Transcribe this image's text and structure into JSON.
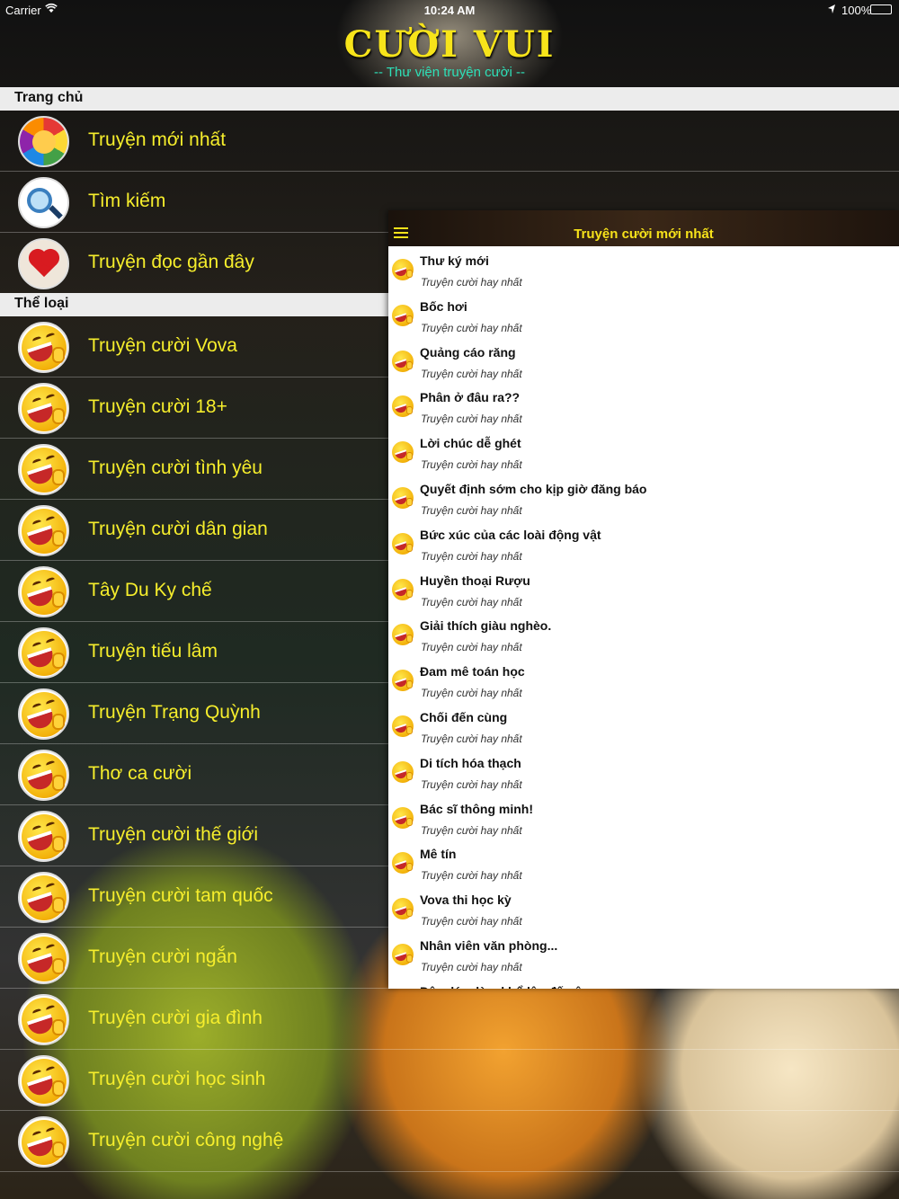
{
  "status_bar": {
    "carrier": "Carrier",
    "time": "10:24 AM",
    "battery": "100%"
  },
  "header": {
    "title": "CƯỜI VUI",
    "subtitle": "-- Thư viện truyện cười --"
  },
  "sections": {
    "home": "Trang chủ",
    "categories": "Thể loại"
  },
  "home_items": [
    {
      "label": "Truyện mới nhất",
      "icon": "clown-icon"
    },
    {
      "label": "Tìm kiếm",
      "icon": "search-icon"
    },
    {
      "label": "Truyện đọc gần đây",
      "icon": "heart-icon"
    }
  ],
  "category_items": [
    {
      "label": "Truyện cười Vova"
    },
    {
      "label": "Truyện cười 18+"
    },
    {
      "label": "Truyện cười tình yêu"
    },
    {
      "label": "Truyện cười dân gian"
    },
    {
      "label": "Tây Du Ky chế"
    },
    {
      "label": "Truyện tiếu lâm"
    },
    {
      "label": "Truyện Trạng Quỳnh"
    },
    {
      "label": "Thơ ca cười"
    },
    {
      "label": "Truyện cười thế giới"
    },
    {
      "label": "Truyện cười tam quốc"
    },
    {
      "label": "Truyện cười ngắn"
    },
    {
      "label": "Truyện cười gia đình"
    },
    {
      "label": "Truyện cười học sinh"
    },
    {
      "label": "Truyện cười công nghệ"
    }
  ],
  "panel": {
    "title": "Truyện cười mới nhất",
    "stories": [
      {
        "title": "Thư ký mới",
        "category": "Truyện cười hay nhất"
      },
      {
        "title": "Bốc hơi",
        "category": "Truyện cười hay nhất"
      },
      {
        "title": "Quảng cáo răng",
        "category": "Truyện cười hay nhất"
      },
      {
        "title": "Phân ở đâu ra??",
        "category": "Truyện cười hay nhất"
      },
      {
        "title": "Lời chúc dễ ghét",
        "category": "Truyện cười hay nhất"
      },
      {
        "title": "Quyết định sớm cho kịp giờ đăng báo",
        "category": "Truyện cười hay nhất"
      },
      {
        "title": "Bức xúc của các loài động vật",
        "category": "Truyện cười hay nhất"
      },
      {
        "title": "Huyền thoại Rượu",
        "category": "Truyện cười hay nhất"
      },
      {
        "title": "Giải thích giàu nghèo.",
        "category": "Truyện cười hay nhất"
      },
      {
        "title": "Đam mê toán học",
        "category": "Truyện cười hay nhất"
      },
      {
        "title": "Chối đến cùng",
        "category": "Truyện cười hay nhất"
      },
      {
        "title": "Di tích hóa thạch",
        "category": "Truyện cười hay nhất"
      },
      {
        "title": "Bác sĩ thông minh!",
        "category": "Truyện cười hay nhất"
      },
      {
        "title": "Mê tín",
        "category": "Truyện cười hay nhất"
      },
      {
        "title": "Vova thi học kỳ",
        "category": "Truyện cười hay nhất"
      },
      {
        "title": "Nhân viên văn phòng...",
        "category": "Truyện cười hay nhất"
      },
      {
        "title": "Dây dám làm khổ lâu đến ông",
        "category": ""
      }
    ]
  },
  "colors": {
    "accent": "#f6ee2c",
    "subtitle": "#2de0b8",
    "panel_bar": "#3a2717"
  }
}
